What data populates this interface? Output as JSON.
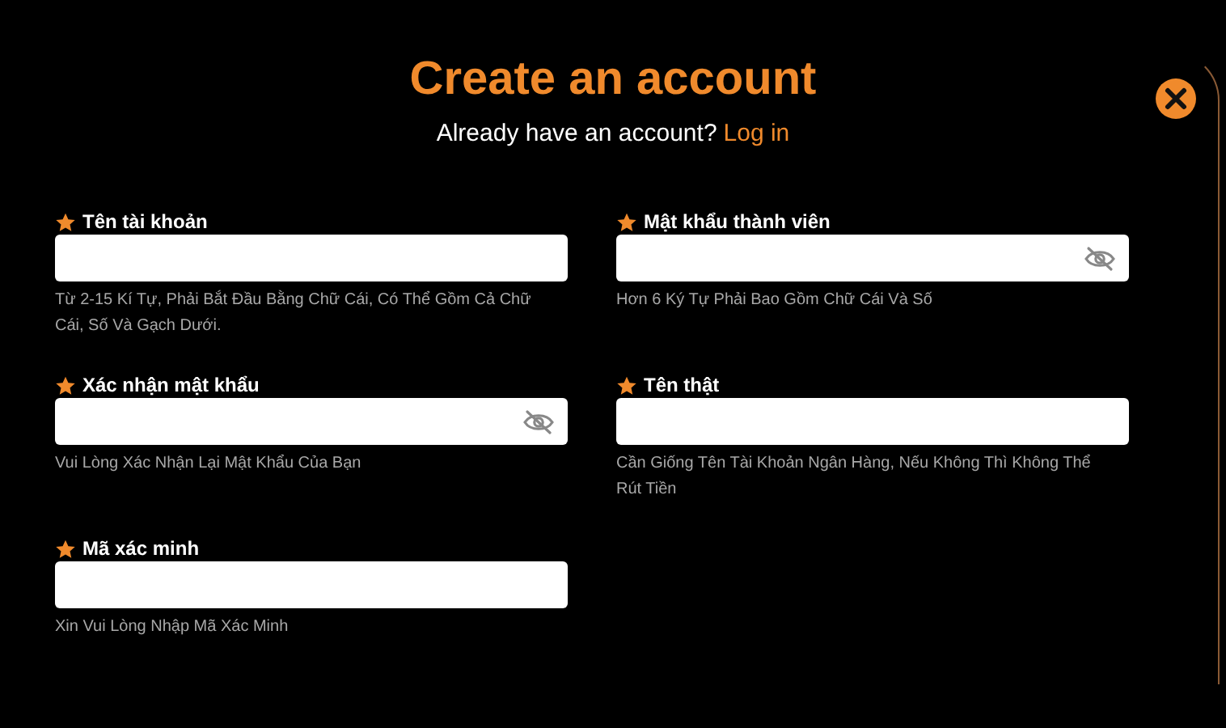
{
  "title": "Create an account",
  "login_prompt": {
    "text": "Already have an account?",
    "link": "Log in"
  },
  "fields": [
    {
      "label": "Tên tài khoản",
      "kind": "text",
      "hint": "Từ 2-15 Kí Tự, Phải Bắt Đầu Bằng Chữ Cái, Có Thể Gồm Cả Chữ Cái, Số Và Gạch Dưới."
    },
    {
      "label": "Mật khẩu thành viên",
      "kind": "password",
      "hint": "Hơn 6 Ký Tự Phải Bao Gồm Chữ Cái Và Số"
    },
    {
      "label": "Xác nhận mật khẩu",
      "kind": "password",
      "hint": "Vui Lòng Xác Nhận Lại Mật Khẩu Của Bạn"
    },
    {
      "label": "Tên thật",
      "kind": "text",
      "hint": "Cần Giống Tên Tài Khoản Ngân Hàng, Nếu Không Thì Không Thể Rút Tiền"
    },
    {
      "label": "Mã xác minh",
      "kind": "text",
      "hint": "Xin Vui Lòng Nhập Mã Xác Minh"
    }
  ]
}
